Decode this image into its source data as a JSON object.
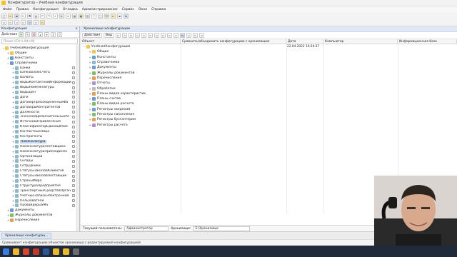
{
  "window": {
    "title": "Конфигуратор - Учебная конфигурация"
  },
  "menu": [
    "Файл",
    "Правка",
    "Конфигурация",
    "Отладка",
    "Администрирование",
    "Сервис",
    "Окна",
    "Справка"
  ],
  "left_panel": {
    "title": "Конфигурация",
    "actions_label": "Действия",
    "search_placeholder": "Поиск (Ctrl+Alt+M)",
    "tree": [
      {
        "label": "УчебнаяКонфигурация",
        "level": 0,
        "exp": "−",
        "icon": "config-icon",
        "color": "y"
      },
      {
        "label": "Общие",
        "level": 1,
        "exp": "+",
        "icon": "common-icon",
        "color": "y"
      },
      {
        "label": "Константы",
        "level": 1,
        "exp": "+",
        "icon": "constants-icon",
        "color": "b"
      },
      {
        "label": "Справочники",
        "level": 1,
        "exp": "−",
        "icon": "catalogs-icon",
        "color": "b"
      },
      {
        "label": "Банки",
        "level": 2,
        "exp": "+",
        "icon": "catalog-icon",
        "color": "t",
        "lock": true
      },
      {
        "label": "БанковскиеСчета",
        "level": 2,
        "exp": "+",
        "icon": "catalog-icon",
        "color": "t",
        "lock": true
      },
      {
        "label": "Валюты",
        "level": 2,
        "exp": "+",
        "icon": "catalog-icon",
        "color": "t",
        "lock": true
      },
      {
        "label": "ВидыКонтактнойИнформации",
        "level": 2,
        "exp": "+",
        "icon": "catalog-icon",
        "color": "t",
        "lock": true
      },
      {
        "label": "ВидыНоменклатуры",
        "level": 2,
        "exp": "+",
        "icon": "catalog-icon",
        "color": "t",
        "lock": true
      },
      {
        "label": "ВидыЦен",
        "level": 2,
        "exp": "+",
        "icon": "catalog-icon",
        "color": "t",
        "lock": true
      },
      {
        "label": "Доги",
        "level": 2,
        "exp": "+",
        "icon": "catalog-icon",
        "color": "t",
        "lock": true
      },
      {
        "label": "ДоговорПрисоединенныеФа",
        "level": 2,
        "exp": "+",
        "icon": "catalog-icon",
        "color": "t",
        "lock": true
      },
      {
        "label": "ДоговорыКонтрагентов",
        "level": 2,
        "exp": "+",
        "icon": "catalog-icon",
        "color": "t",
        "lock": true
      },
      {
        "label": "Должности",
        "level": 2,
        "exp": "+",
        "icon": "catalog-icon",
        "color": "t",
        "lock": true
      },
      {
        "label": "ЗначенияДополнительныхРе",
        "level": 2,
        "exp": "+",
        "icon": "catalog-icon",
        "color": "t",
        "lock": true
      },
      {
        "label": "ИсточникиПривлечения",
        "level": 2,
        "exp": "+",
        "icon": "catalog-icon",
        "color": "t",
        "lock": true
      },
      {
        "label": "КлассификаторЕдиницИзме",
        "level": 2,
        "exp": "+",
        "icon": "catalog-icon",
        "color": "t",
        "lock": true
      },
      {
        "label": "КонтактныеЛица",
        "level": 2,
        "exp": "+",
        "icon": "catalog-icon",
        "color": "t",
        "lock": true
      },
      {
        "label": "Контрагенты",
        "level": 2,
        "exp": "+",
        "icon": "catalog-icon",
        "color": "t",
        "lock": true
      },
      {
        "label": "Номенклатура",
        "level": 2,
        "exp": "+",
        "icon": "catalog-icon",
        "color": "t",
        "lock": true,
        "selected": true
      },
      {
        "label": "НоменклатураПоставщика",
        "level": 2,
        "exp": "+",
        "icon": "catalog-icon",
        "color": "t",
        "lock": true
      },
      {
        "label": "НоменклатураПрисоединен",
        "level": 2,
        "exp": "+",
        "icon": "catalog-icon",
        "color": "t",
        "lock": true
      },
      {
        "label": "Организации",
        "level": 2,
        "exp": "+",
        "icon": "catalog-icon",
        "color": "t",
        "lock": true
      },
      {
        "label": "Склады",
        "level": 2,
        "exp": "+",
        "icon": "catalog-icon",
        "color": "t",
        "lock": true
      },
      {
        "label": "Сотрудники",
        "level": 2,
        "exp": "+",
        "icon": "catalog-icon",
        "color": "t",
        "lock": true
      },
      {
        "label": "СтатусыЗаказовКлиентов",
        "level": 2,
        "exp": "+",
        "icon": "catalog-icon",
        "color": "t",
        "lock": true
      },
      {
        "label": "СтатусыЗаказовПоставщик",
        "level": 2,
        "exp": "+",
        "icon": "catalog-icon",
        "color": "t",
        "lock": true
      },
      {
        "label": "СтраныМира",
        "level": 2,
        "exp": "+",
        "icon": "catalog-icon",
        "color": "t",
        "lock": true
      },
      {
        "label": "СтруктураПредприятия",
        "level": 2,
        "exp": "+",
        "icon": "catalog-icon",
        "color": "t",
        "lock": true
      },
      {
        "label": "ТранспортныеСредстваОрган",
        "level": 2,
        "exp": "+",
        "icon": "catalog-icon",
        "color": "t",
        "lock": true
      },
      {
        "label": "УчетныеЗаписиЭлектронной",
        "level": 2,
        "exp": "+",
        "icon": "catalog-icon",
        "color": "t",
        "lock": true
      },
      {
        "label": "Пользователи",
        "level": 2,
        "exp": "+",
        "icon": "catalog-icon",
        "color": "t",
        "lock": true
      },
      {
        "label": "ПровайдерыSMS",
        "level": 2,
        "exp": "+",
        "icon": "catalog-icon",
        "color": "t",
        "lock": true
      },
      {
        "label": "Документы",
        "level": 1,
        "exp": "+",
        "icon": "documents-icon",
        "color": "b"
      },
      {
        "label": "Журналы документов",
        "level": 1,
        "exp": "+",
        "icon": "journals-icon",
        "color": "g"
      },
      {
        "label": "Перечисления",
        "level": 1,
        "exp": "+",
        "icon": "enums-icon",
        "color": "o"
      }
    ]
  },
  "right_panel": {
    "title": "Хранилище конфигурации",
    "actions_label": "Действия",
    "view_label": "Вид",
    "columns": [
      "Объект",
      "Сравнить/объединить конфигурацию с хранилищем",
      "Дата",
      "Компьютер",
      "Информационная база"
    ],
    "rows": [
      {
        "label": "УчебнаяКонфигурация",
        "level": 0,
        "exp": "−",
        "icon": "config-icon",
        "color": "y",
        "date": "22.04.2022 10:24:37"
      },
      {
        "label": "Общие",
        "level": 1,
        "exp": "+",
        "icon": "common-icon",
        "color": "y"
      },
      {
        "label": "Константы",
        "level": 1,
        "exp": "+",
        "icon": "constants-icon",
        "color": "b"
      },
      {
        "label": "Справочники",
        "level": 1,
        "exp": "+",
        "icon": "catalogs-icon",
        "color": "t"
      },
      {
        "label": "Документы",
        "level": 1,
        "exp": "+",
        "icon": "documents-icon",
        "color": "b"
      },
      {
        "label": "Журналы документов",
        "level": 1,
        "exp": "+",
        "icon": "journals-icon",
        "color": "g"
      },
      {
        "label": "Перечисления",
        "level": 1,
        "exp": "+",
        "icon": "enums-icon",
        "color": "o"
      },
      {
        "label": "Отчеты",
        "level": 1,
        "exp": "+",
        "icon": "reports-icon",
        "color": "p"
      },
      {
        "label": "Обработки",
        "level": 1,
        "exp": "+",
        "icon": "processors-icon",
        "color": "gr"
      },
      {
        "label": "Планы видов характеристик",
        "level": 1,
        "exp": "+",
        "icon": "chart-of-characteristics-icon",
        "color": "o"
      },
      {
        "label": "Планы счетов",
        "level": 1,
        "exp": "+",
        "icon": "chart-of-accounts-icon",
        "color": "b"
      },
      {
        "label": "Планы видов расчета",
        "level": 1,
        "exp": "+",
        "icon": "chart-of-calculation-icon",
        "color": "g"
      },
      {
        "label": "Регистры сведений",
        "level": 1,
        "exp": "+",
        "icon": "info-registers-icon",
        "color": "b"
      },
      {
        "label": "Регистры накопления",
        "level": 1,
        "exp": "+",
        "icon": "accumulation-registers-icon",
        "color": "g"
      },
      {
        "label": "Регистры бухгалтерии",
        "level": 1,
        "exp": "+",
        "icon": "accounting-registers-icon",
        "color": "o"
      },
      {
        "label": "Регистры расчета",
        "level": 1,
        "exp": "+",
        "icon": "calculation-registers-icon",
        "color": "p"
      }
    ],
    "footer": {
      "user_label": "Текущий пользователь:",
      "user_value": "Администратор",
      "storage_label": "Хранилище:",
      "storage_value": "E:\\Хранилище"
    }
  },
  "window_tab": "Хранилище конфигурац...",
  "status_text": "Сравнивает конфигурацию объектов хранилища с редактируемой конфигурацией"
}
